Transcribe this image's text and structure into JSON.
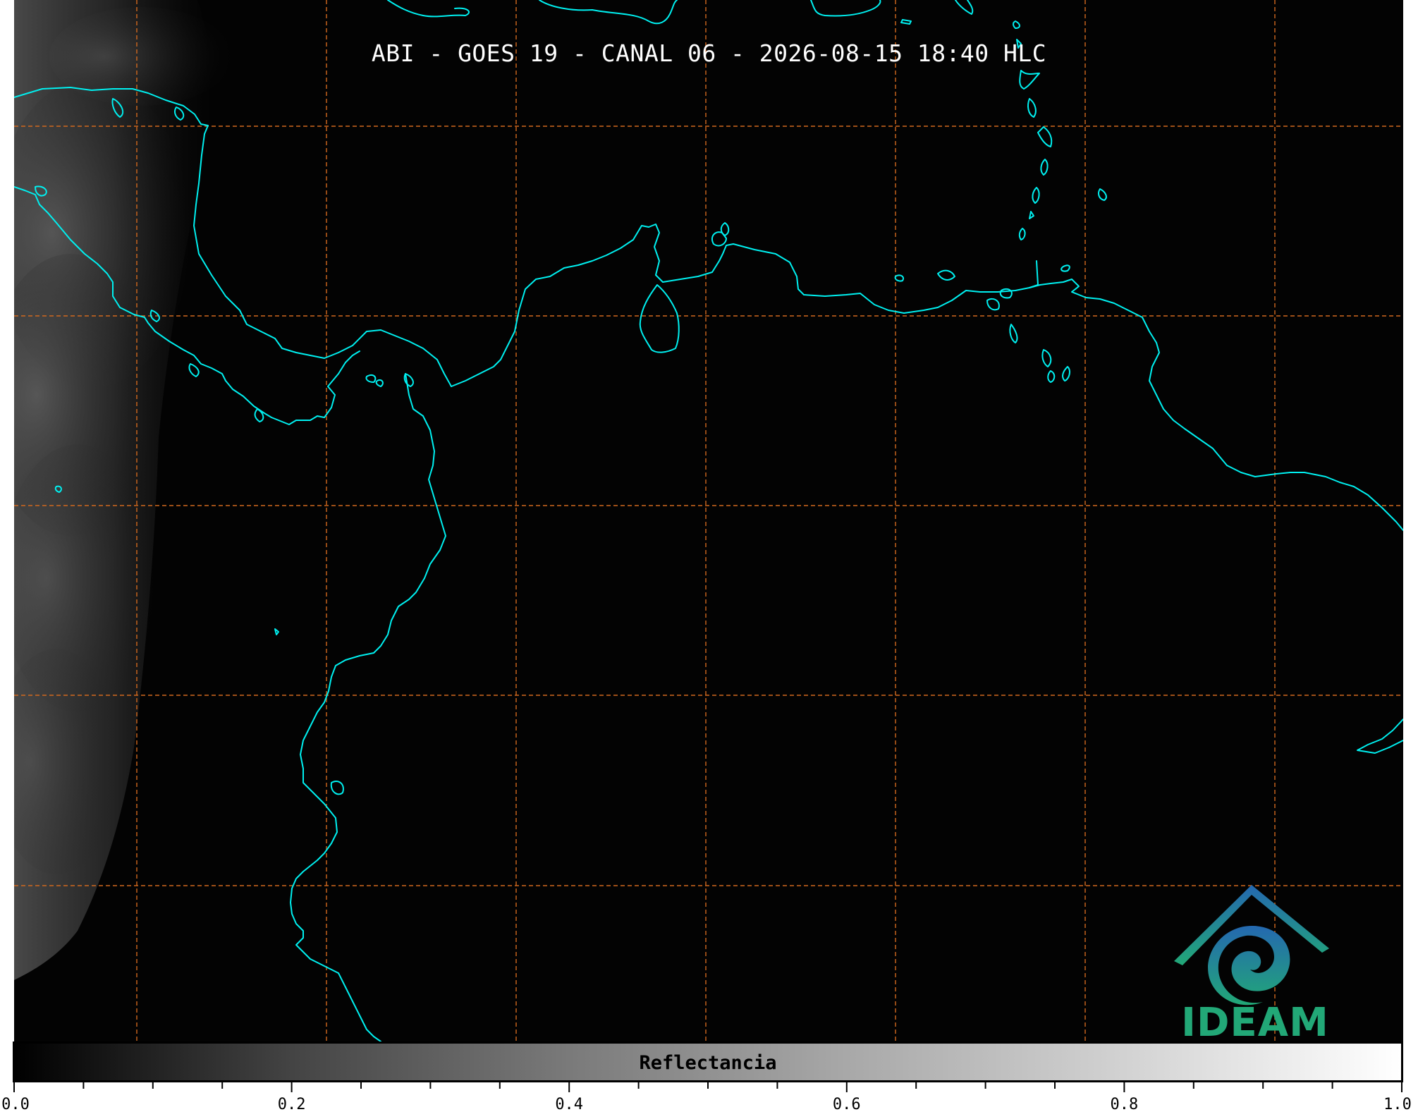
{
  "map": {
    "title": "ABI - GOES 19 - CANAL 06 - 2026-08-15 18:40 HLC",
    "gridline_color": "#d2691e",
    "coastline_color": "#00f0f0",
    "background_color": "#030303"
  },
  "colorbar": {
    "label": "Reflectancia",
    "tick_labels": [
      "0.0",
      "0.2",
      "0.4",
      "0.6",
      "0.8",
      "1.0"
    ],
    "range": [
      0.0,
      1.0
    ],
    "colormap": "grayscale"
  },
  "logo": {
    "text": "IDEAM",
    "color": "#22a877"
  }
}
